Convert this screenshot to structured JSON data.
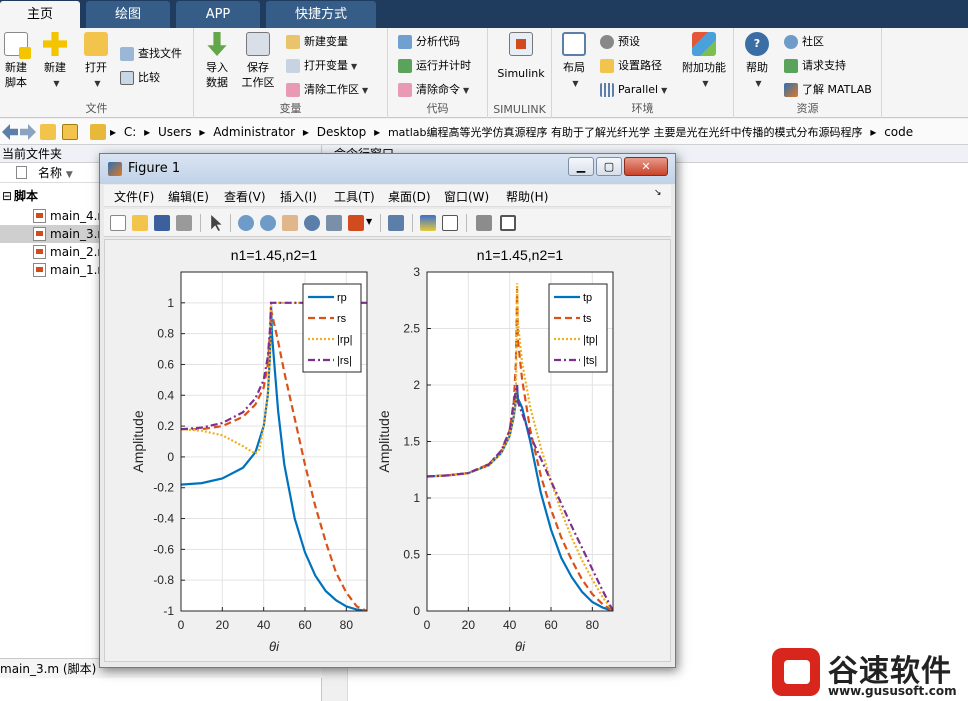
{
  "tabs": [
    {
      "label": "主页"
    },
    {
      "label": "绘图"
    },
    {
      "label": "APP"
    },
    {
      "label": "快捷方式"
    }
  ],
  "ribbon": {
    "file": {
      "title": "文件",
      "new_script": "新建\n脚本",
      "new": "新建",
      "open": "打开",
      "find_files": "查找文件",
      "compare": "比较"
    },
    "variable": {
      "title": "变量",
      "import": "导入\n数据",
      "save": "保存\n工作区",
      "new_var": "新建变量",
      "open_var": "打开变量",
      "clear_ws": "清除工作区"
    },
    "code": {
      "title": "代码",
      "analyze": "分析代码",
      "run_time": "运行并计时",
      "clear_cmd": "清除命令"
    },
    "simulink": {
      "title": "SIMULINK",
      "label": "Simulink"
    },
    "env": {
      "title": "环境",
      "layout": "布局",
      "prefs": "预设",
      "set_path": "设置路径",
      "parallel": "Parallel",
      "addons": "附加功能"
    },
    "resources": {
      "title": "资源",
      "help": "帮助",
      "community": "社区",
      "support": "请求支持",
      "learn": "了解 MATLAB"
    }
  },
  "address": {
    "crumbs": [
      "C:",
      "Users",
      "Administrator",
      "Desktop",
      "matlab编程高等光学仿真源程序 有助于了解光纤光学 主要是光在光纤中传播的模式分布源码程序",
      "code"
    ]
  },
  "file_panel": {
    "title": "当前文件夹",
    "col_name": "名称",
    "group": "脚本",
    "files": [
      "main_4.m",
      "main_3.m",
      "main_2.m",
      "main_1.m"
    ],
    "status": "main_3.m  (脚本)"
  },
  "cmd_window": {
    "title": "命令行窗口"
  },
  "figure": {
    "title": "Figure 1",
    "menus": [
      "文件(F)",
      "编辑(E)",
      "查看(V)",
      "插入(I)",
      "工具(T)",
      "桌面(D)",
      "窗口(W)",
      "帮助(H)"
    ]
  },
  "watermark": {
    "text": "谷速软件",
    "url": "www.gususoft.com"
  },
  "colors": {
    "tp": "#0072bd",
    "ts": "#d95319",
    "abs_p": "#edb120",
    "abs_s": "#7e2f8e"
  },
  "chart_data": [
    {
      "type": "line",
      "title": "n1=1.45,n2=1",
      "xlabel": "θi",
      "ylabel": "Amplitude",
      "xlim": [
        0,
        90
      ],
      "ylim": [
        -1,
        1.2
      ],
      "xticks": [
        0,
        20,
        40,
        60,
        80
      ],
      "yticks": [
        -1,
        -0.8,
        -0.6,
        -0.4,
        -0.2,
        0,
        0.2,
        0.4,
        0.6,
        0.8,
        1
      ],
      "grid": true,
      "legend_position": "top-right",
      "series": [
        {
          "name": "rp",
          "x": [
            0,
            10,
            20,
            30,
            36,
            40,
            42,
            43,
            43.6,
            44,
            47,
            50,
            55,
            60,
            65,
            70,
            75,
            80,
            85,
            90
          ],
          "y": [
            -0.18,
            -0.17,
            -0.14,
            -0.07,
            0.03,
            0.2,
            0.4,
            0.65,
            0.98,
            0.8,
            0.3,
            -0.05,
            -0.4,
            -0.62,
            -0.77,
            -0.87,
            -0.93,
            -0.97,
            -0.99,
            -1
          ]
        },
        {
          "name": "rs",
          "x": [
            0,
            10,
            20,
            30,
            36,
            40,
            42,
            43,
            43.6,
            44,
            47,
            50,
            55,
            60,
            65,
            70,
            75,
            80,
            85,
            90
          ],
          "y": [
            0.18,
            0.18,
            0.2,
            0.26,
            0.34,
            0.45,
            0.6,
            0.8,
            0.95,
            0.93,
            0.75,
            0.55,
            0.25,
            -0.05,
            -0.32,
            -0.55,
            -0.75,
            -0.88,
            -0.97,
            -1
          ]
        },
        {
          "name": "|rp|",
          "x": [
            0,
            10,
            20,
            30,
            36,
            38,
            40,
            42,
            43,
            43.6,
            44,
            50,
            60,
            70,
            80,
            90
          ],
          "y": [
            0.18,
            0.17,
            0.14,
            0.07,
            0.02,
            0.05,
            0.2,
            0.4,
            0.65,
            1,
            1,
            1,
            1,
            1,
            1,
            1
          ]
        },
        {
          "name": "|rs|",
          "x": [
            0,
            10,
            20,
            30,
            36,
            40,
            42,
            43,
            43.6,
            44,
            50,
            60,
            70,
            80,
            90
          ],
          "y": [
            0.18,
            0.19,
            0.22,
            0.29,
            0.38,
            0.5,
            0.65,
            0.82,
            1,
            1,
            1,
            1,
            1,
            1,
            1
          ]
        }
      ]
    },
    {
      "type": "line",
      "title": "n1=1.45,n2=1",
      "xlabel": "θi",
      "ylabel": "Amplitude",
      "xlim": [
        0,
        90
      ],
      "ylim": [
        0,
        3
      ],
      "xticks": [
        0,
        20,
        40,
        60,
        80
      ],
      "yticks": [
        0,
        0.5,
        1,
        1.5,
        2,
        2.5,
        3
      ],
      "grid": true,
      "legend_position": "top-right",
      "series": [
        {
          "name": "tp",
          "x": [
            0,
            10,
            20,
            30,
            36,
            40,
            42,
            43,
            43.6,
            44,
            46,
            50,
            55,
            60,
            65,
            70,
            75,
            80,
            85,
            90
          ],
          "y": [
            1.19,
            1.2,
            1.22,
            1.29,
            1.4,
            1.55,
            1.72,
            1.86,
            1.98,
            1.88,
            1.8,
            1.5,
            1.05,
            0.72,
            0.47,
            0.3,
            0.17,
            0.08,
            0.03,
            0
          ]
        },
        {
          "name": "ts",
          "x": [
            0,
            10,
            20,
            30,
            36,
            40,
            42,
            43,
            43.6,
            44,
            46,
            50,
            55,
            60,
            65,
            70,
            75,
            80,
            85,
            90
          ],
          "y": [
            1.19,
            1.2,
            1.22,
            1.3,
            1.42,
            1.6,
            1.85,
            2.2,
            2.85,
            2.4,
            2.05,
            1.6,
            1.2,
            0.9,
            0.65,
            0.45,
            0.28,
            0.15,
            0.06,
            0
          ]
        },
        {
          "name": "|tp|",
          "x": [
            0,
            10,
            20,
            30,
            36,
            40,
            42,
            43,
            43.6,
            44,
            46,
            50,
            55,
            60,
            65,
            70,
            75,
            80,
            85,
            90
          ],
          "y": [
            1.19,
            1.2,
            1.22,
            1.29,
            1.4,
            1.55,
            1.72,
            1.86,
            2.9,
            2.55,
            2.2,
            1.8,
            1.45,
            1.15,
            0.88,
            0.65,
            0.45,
            0.28,
            0.12,
            0
          ]
        },
        {
          "name": "|ts|",
          "x": [
            0,
            10,
            20,
            30,
            36,
            40,
            42,
            43,
            43.6,
            44,
            46,
            50,
            55,
            60,
            65,
            70,
            75,
            80,
            85,
            90
          ],
          "y": [
            1.19,
            1.2,
            1.22,
            1.3,
            1.42,
            1.6,
            1.85,
            1.95,
            2,
            1.85,
            1.75,
            1.55,
            1.35,
            1.15,
            0.95,
            0.75,
            0.56,
            0.37,
            0.18,
            0
          ]
        }
      ]
    }
  ]
}
